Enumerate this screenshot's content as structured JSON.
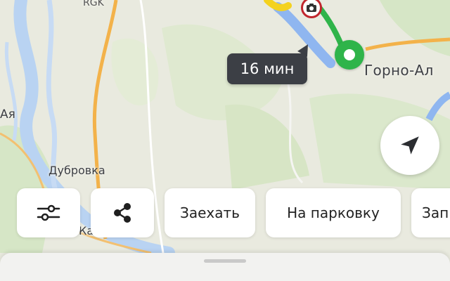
{
  "map": {
    "labels": {
      "rgk": "RGK",
      "aya": "Ая",
      "dubrovka": "Дубровка",
      "katun": "Катун",
      "gorno_altaysk": "Горно-Ал"
    },
    "route_color": "#2fb44a",
    "river_color": "#b9d3f2"
  },
  "route": {
    "eta": "16 мин"
  },
  "actions": {
    "enter": "Заехать",
    "parking": "На парковку",
    "partial": "Зап"
  },
  "icons": {
    "filters": "sliders-icon",
    "share": "share-icon",
    "locate": "navigation-arrow-icon",
    "camera": "speed-camera-icon"
  }
}
